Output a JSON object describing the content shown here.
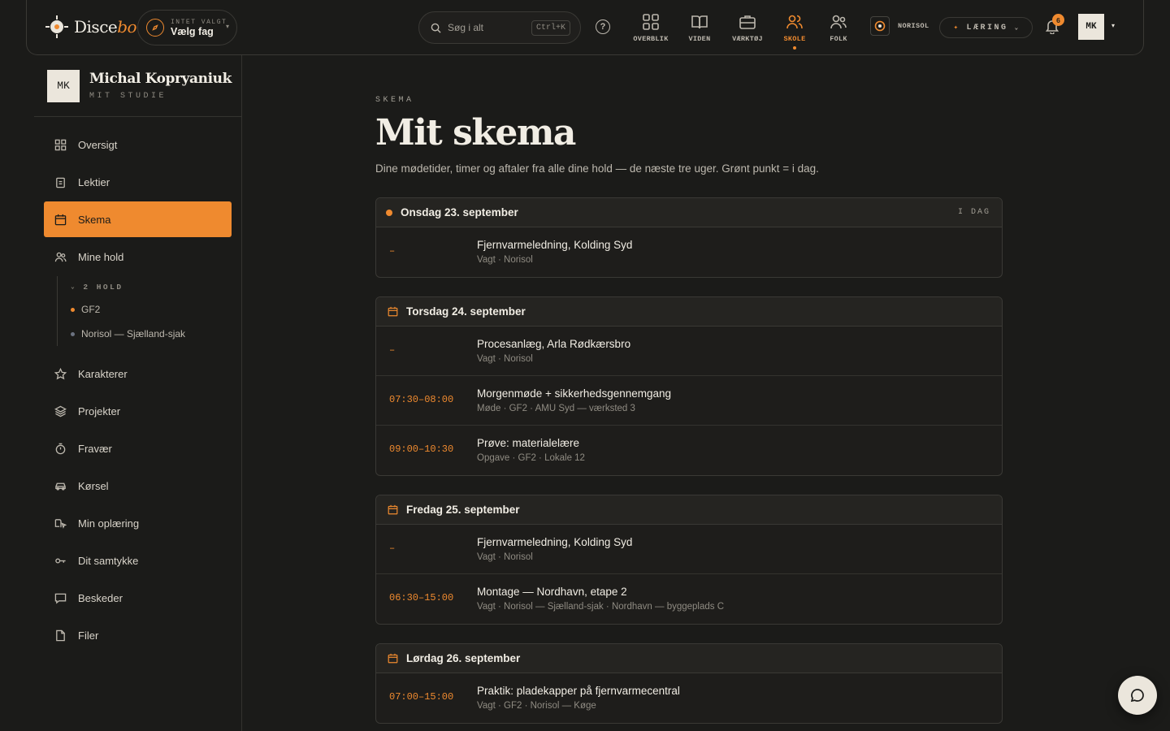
{
  "brand": {
    "name_main": "Disce",
    "name_accent": "bo",
    "accent_color": "#ef8a2f"
  },
  "course_picker": {
    "small_label": "INTET VALGT",
    "value": "Vælg fag"
  },
  "search": {
    "placeholder": "Søg i alt",
    "shortcut": "Ctrl+K"
  },
  "help_icon": "?",
  "nav": {
    "items": [
      {
        "label": "OVERBLIK",
        "icon": "grid-icon"
      },
      {
        "label": "VIDEN",
        "icon": "book-icon"
      },
      {
        "label": "VÆRKTØJ",
        "icon": "briefcase-icon"
      },
      {
        "label": "SKOLE",
        "icon": "users-icon",
        "active": true
      },
      {
        "label": "FOLK",
        "icon": "people-icon"
      }
    ]
  },
  "org": {
    "name": "NORISOL"
  },
  "mode": {
    "label": "LÆRING"
  },
  "notifications": {
    "count": "6"
  },
  "user": {
    "initials": "MK"
  },
  "sidebar": {
    "profile": {
      "initials": "MK",
      "name": "Michal Kopryaniuk",
      "subtitle": "MIT STUDIE"
    },
    "items": [
      {
        "label": "Oversigt",
        "icon": "dashboard-icon"
      },
      {
        "label": "Lektier",
        "icon": "clipboard-icon"
      },
      {
        "label": "Skema",
        "icon": "calendar-icon",
        "active": true
      },
      {
        "label": "Mine hold",
        "icon": "team-icon"
      },
      {
        "label": "Karakterer",
        "icon": "star-icon"
      },
      {
        "label": "Projekter",
        "icon": "layers-icon"
      },
      {
        "label": "Fravær",
        "icon": "stopwatch-icon"
      },
      {
        "label": "Kørsel",
        "icon": "car-icon"
      },
      {
        "label": "Min oplæring",
        "icon": "book-cursor-icon"
      },
      {
        "label": "Dit samtykke",
        "icon": "key-icon"
      },
      {
        "label": "Beskeder",
        "icon": "message-icon"
      },
      {
        "label": "Filer",
        "icon": "file-icon"
      }
    ],
    "hold_group": {
      "heading": "2 HOLD",
      "items": [
        {
          "label": "GF2",
          "dot_color": "#ef8a2f"
        },
        {
          "label": "Norisol — Sjælland-sjak",
          "dot_color": "#6b7280"
        }
      ]
    }
  },
  "page": {
    "eyebrow": "SKEMA",
    "title": "Mit skema",
    "lead": "Dine mødetider, timer og aftaler fra alle dine hold — de næste tre uger. Grønt punkt = i dag."
  },
  "days": [
    {
      "label": "Onsdag 23. september",
      "today": true,
      "today_label": "I DAG",
      "events": [
        {
          "time": "–",
          "title": "Fjernvarmeledning, Kolding Syd",
          "meta": "Vagt · Norisol"
        }
      ]
    },
    {
      "label": "Torsdag 24. september",
      "events": [
        {
          "time": "–",
          "title": "Procesanlæg, Arla Rødkærsbro",
          "meta": "Vagt · Norisol"
        },
        {
          "time": "07:30–08:00",
          "title": "Morgenmøde + sikkerhedsgennemgang",
          "meta": "Møde · GF2 · AMU Syd — værksted 3"
        },
        {
          "time": "09:00–10:30",
          "title": "Prøve: materialelære",
          "meta": "Opgave · GF2 · Lokale 12"
        }
      ]
    },
    {
      "label": "Fredag 25. september",
      "events": [
        {
          "time": "–",
          "title": "Fjernvarmeledning, Kolding Syd",
          "meta": "Vagt · Norisol"
        },
        {
          "time": "06:30–15:00",
          "title": "Montage — Nordhavn, etape 2",
          "meta": "Vagt · Norisol — Sjælland-sjak · Nordhavn — byggeplads C"
        }
      ]
    },
    {
      "label": "Lørdag 26. september",
      "events": [
        {
          "time": "07:00–15:00",
          "title": "Praktik: pladekapper på fjernvarmecentral",
          "meta": "Vagt · GF2 · Norisol — Køge"
        }
      ]
    }
  ]
}
